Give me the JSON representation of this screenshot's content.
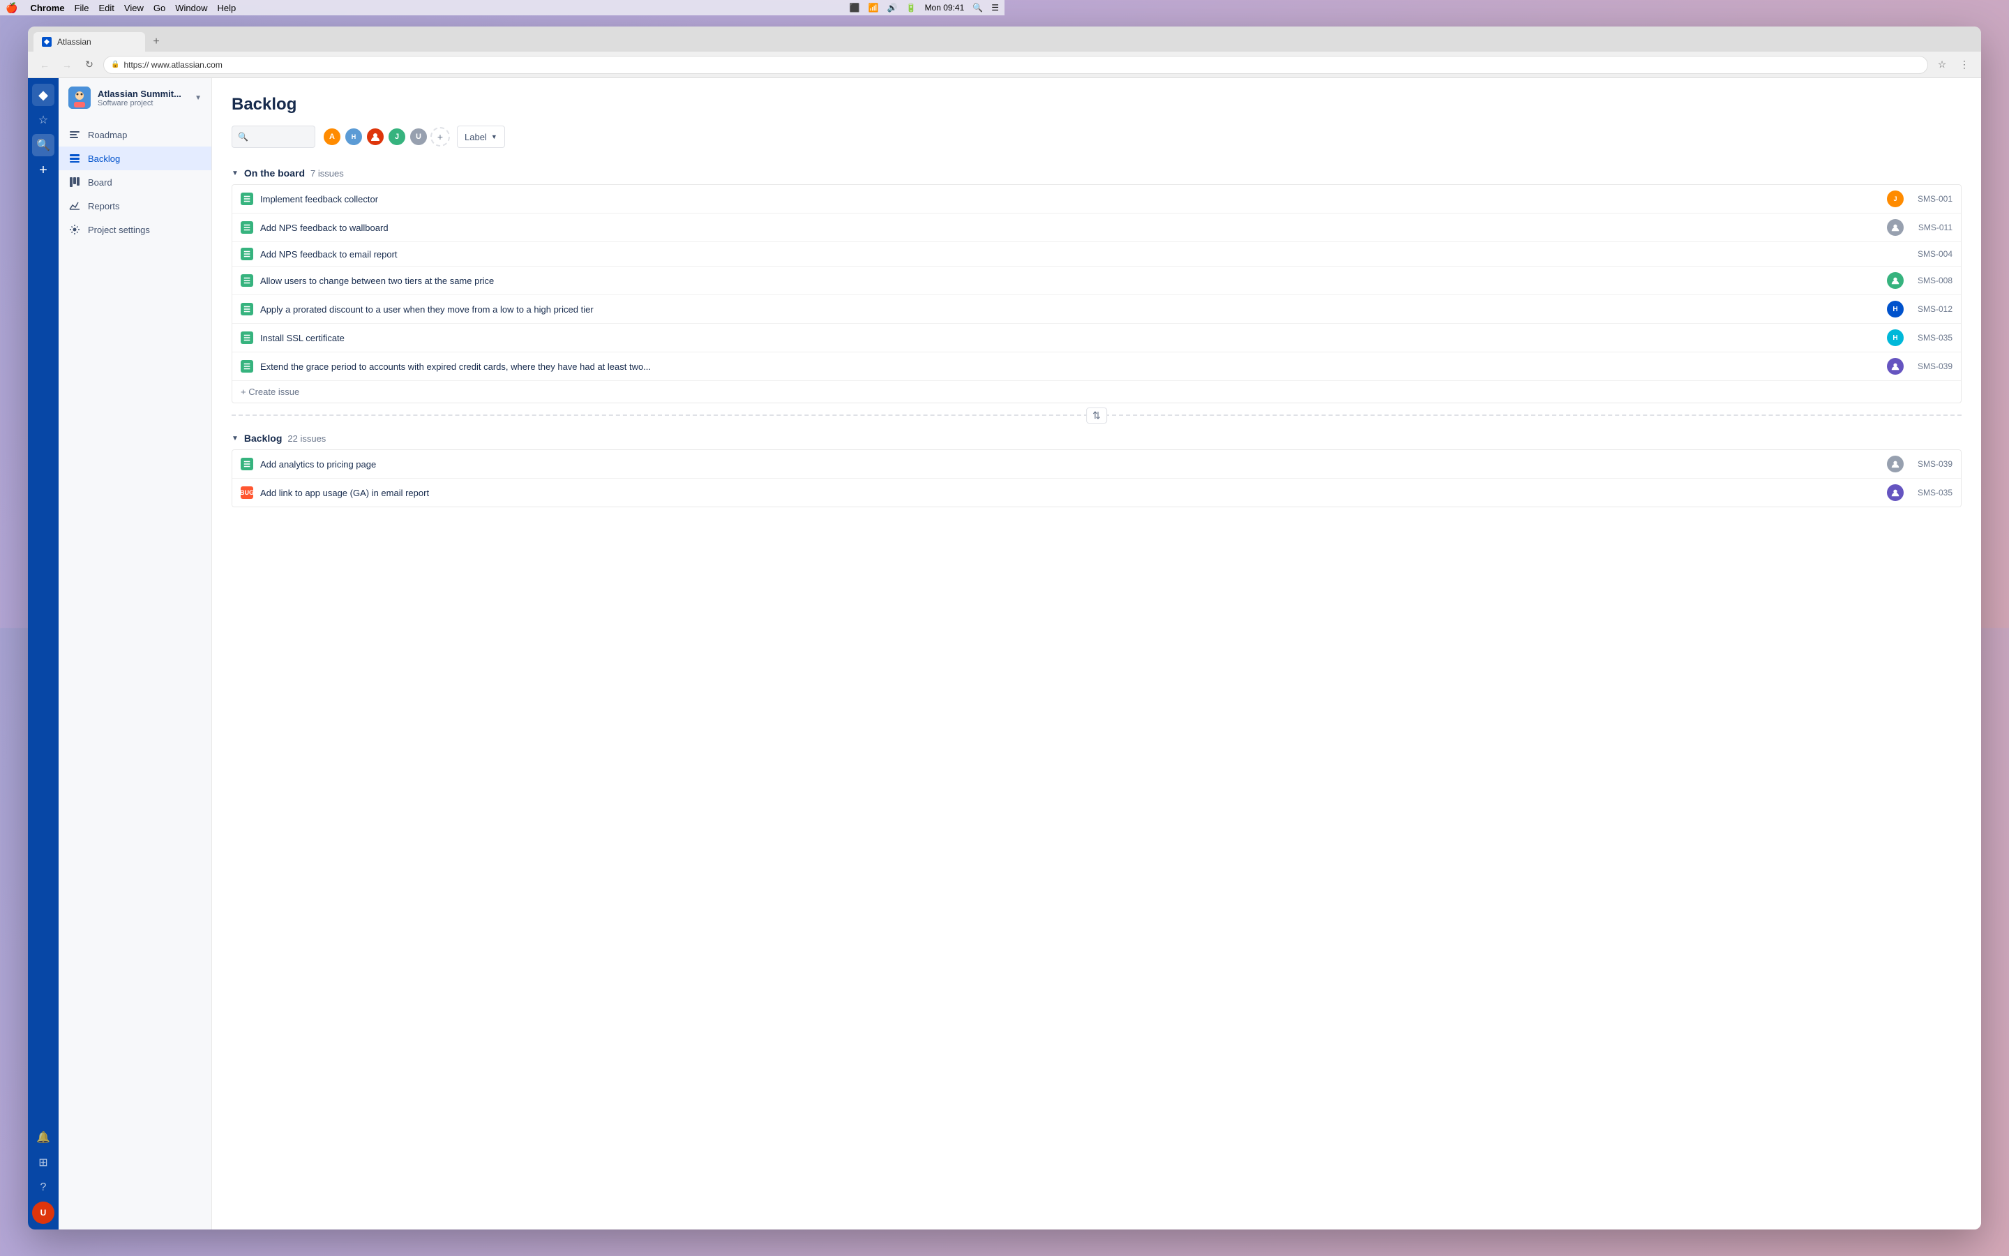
{
  "menubar": {
    "apple": "🍎",
    "chrome": "Chrome",
    "file": "File",
    "edit": "Edit",
    "view": "View",
    "go": "Go",
    "window": "Window",
    "help": "Help",
    "time": "Mon 09:41"
  },
  "browser": {
    "tab_title": "Atlassian",
    "url": "https://  www.atlassian.com"
  },
  "project": {
    "name": "Atlassian Summit...",
    "type": "Software project"
  },
  "sidebar": {
    "roadmap": "Roadmap",
    "backlog": "Backlog",
    "board": "Board",
    "reports": "Reports",
    "project_settings": "Project settings"
  },
  "page": {
    "title": "Backlog",
    "label_dropdown": "Label",
    "search_placeholder": ""
  },
  "on_the_board": {
    "section": "On the board",
    "count": "7 issues",
    "issues": [
      {
        "id": "SMS-001",
        "title": "Implement feedback collector",
        "type": "story",
        "avatar": "J",
        "avatar_color": "av-orange"
      },
      {
        "id": "SMS-011",
        "title": "Add NPS feedback to wallboard",
        "type": "story",
        "avatar": "U",
        "avatar_color": "av-gray"
      },
      {
        "id": "SMS-004",
        "title": "Add NPS feedback to email report",
        "type": "story",
        "avatar": "",
        "avatar_color": ""
      },
      {
        "id": "SMS-008",
        "title": "Allow users to change between two tiers at the same price",
        "type": "story",
        "avatar": "U",
        "avatar_color": "av-green"
      },
      {
        "id": "SMS-012",
        "title": "Apply a prorated discount to a user when they move from a low to a high priced tier",
        "type": "story",
        "avatar": "H",
        "avatar_color": "av-blue"
      },
      {
        "id": "SMS-035",
        "title": "Install SSL certificate",
        "type": "story",
        "avatar": "H",
        "avatar_color": "av-teal"
      },
      {
        "id": "SMS-039",
        "title": "Extend the grace period to accounts with expired credit cards, where they have had at least two...",
        "type": "story",
        "avatar": "U",
        "avatar_color": "av-purple"
      }
    ],
    "create_issue": "+ Create issue"
  },
  "backlog": {
    "section": "Backlog",
    "count": "22 issues",
    "issues": [
      {
        "id": "SMS-039",
        "title": "Add analytics to pricing page",
        "type": "story",
        "avatar": "U",
        "avatar_color": "av-gray"
      },
      {
        "id": "SMS-035",
        "title": "Add link to app usage (GA) in email report",
        "type": "bug",
        "avatar": "U",
        "avatar_color": "av-purple"
      }
    ]
  },
  "avatars": [
    {
      "letter": "A",
      "color": "av-orange"
    },
    {
      "letter": "H",
      "color": "av-blue"
    },
    {
      "letter": "U",
      "color": "av-red"
    },
    {
      "letter": "J",
      "color": "av-green"
    },
    {
      "letter": "U",
      "color": "av-gray"
    }
  ]
}
